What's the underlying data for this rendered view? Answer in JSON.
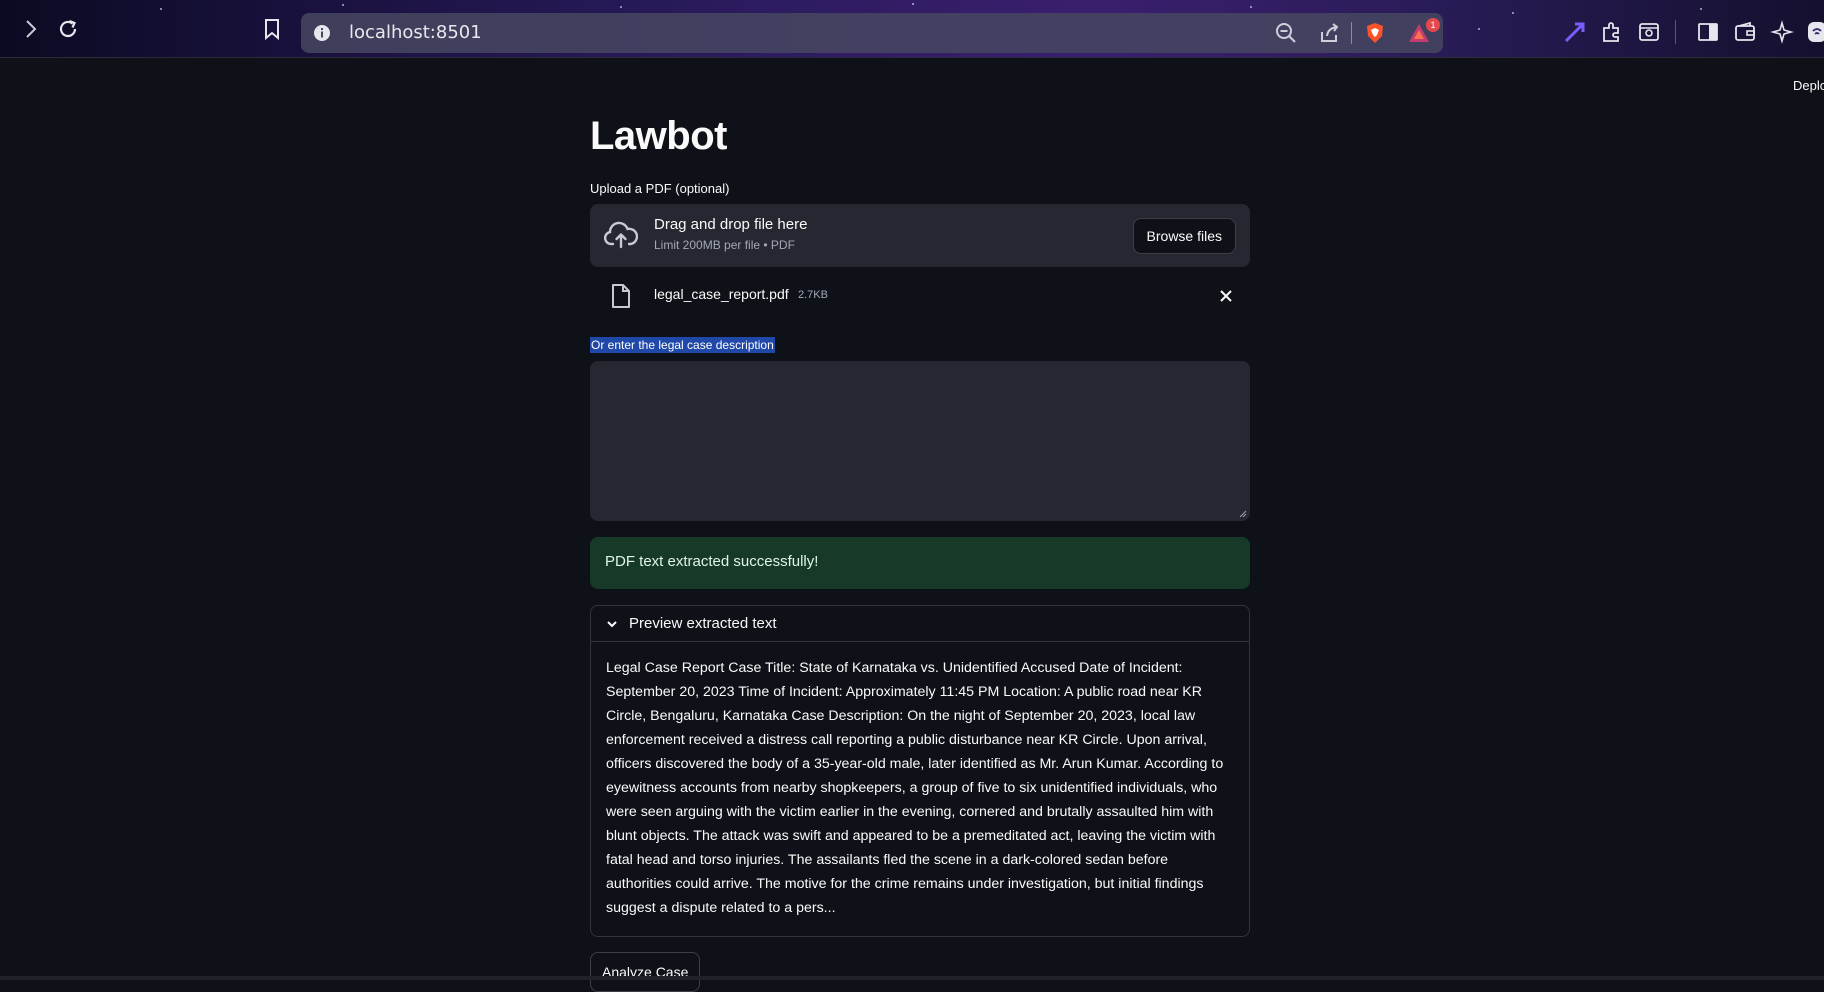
{
  "browser": {
    "url": "localhost:8501",
    "alert_badge_count": "1"
  },
  "header": {
    "deploy_label": "Deploy"
  },
  "app": {
    "title": "Lawbot",
    "upload": {
      "label": "Upload a PDF (optional)",
      "drop_title": "Drag and drop file here",
      "drop_subtitle": "Limit 200MB per file • PDF",
      "browse_label": "Browse files"
    },
    "uploaded_file": {
      "name": "legal_case_report.pdf",
      "size": "2.7KB"
    },
    "description": {
      "label": "Or enter the legal case description",
      "value": ""
    },
    "success_message": "PDF text extracted successfully!",
    "preview": {
      "title": "Preview extracted text",
      "text": "Legal Case Report Case Title: State of Karnataka vs. Unidentified Accused Date of Incident: September 20, 2023 Time of Incident: Approximately 11:45 PM Location: A public road near KR Circle, Bengaluru, Karnataka Case Description: On the night of September 20, 2023, local law enforcement received a distress call reporting a public disturbance near KR Circle. Upon arrival, officers discovered the body of a 35-year-old male, later identified as Mr. Arun Kumar. According to eyewitness accounts from nearby shopkeepers, a group of five to six unidentified individuals, who were seen arguing with the victim earlier in the evening, cornered and brutally assaulted him with blunt objects. The attack was swift and appeared to be a premeditated act, leaving the victim with fatal head and torso injuries. The assailants fled the scene in a dark-colored sedan before authorities could arrive. The motive for the crime remains under investigation, but initial findings suggest a dispute related to a pers..."
    },
    "analyze_label": "Analyze Case"
  },
  "colors": {
    "background": "#0e1117",
    "widget_bg": "#262730",
    "success_bg": "#173928",
    "selection": "#1f48a8"
  }
}
